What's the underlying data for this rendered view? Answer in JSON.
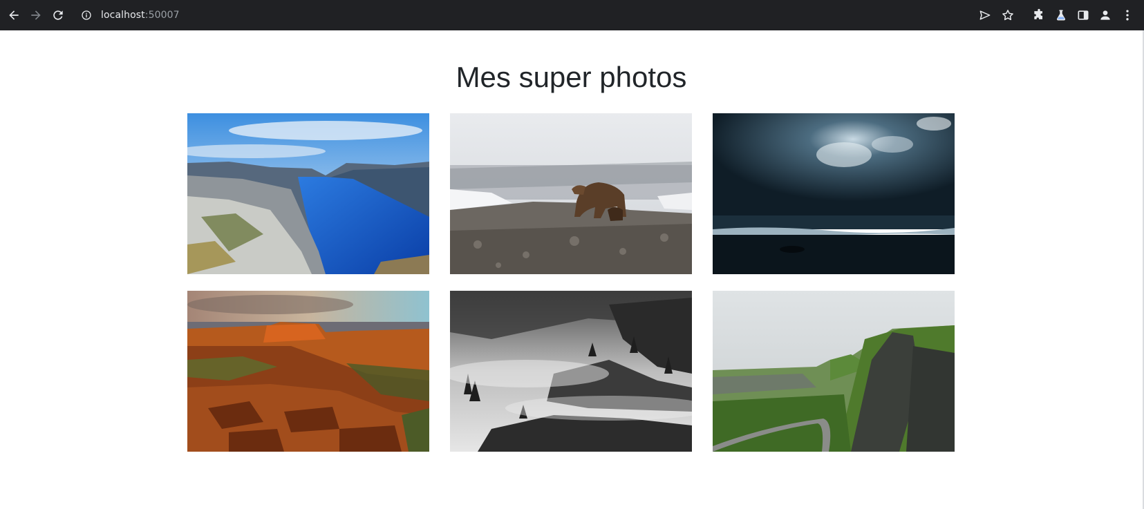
{
  "browser": {
    "url_host": "localhost",
    "url_port": ":50007",
    "icons": [
      "back-arrow-icon",
      "forward-arrow-icon",
      "reload-icon",
      "site-info-icon",
      "send-icon",
      "star-icon",
      "extensions-icon",
      "lab-flask-icon",
      "side-panel-icon",
      "profile-icon",
      "more-vert-icon"
    ]
  },
  "page": {
    "title": "Mes super photos"
  },
  "gallery": {
    "photos": [
      {
        "subject": "fjord-cliff",
        "index": 1
      },
      {
        "subject": "bear-on-rocks",
        "index": 2
      },
      {
        "subject": "stormy-sea",
        "index": 3
      },
      {
        "subject": "red-canyon-sunset",
        "index": 4
      },
      {
        "subject": "misty-forest-bw",
        "index": 5
      },
      {
        "subject": "green-highlands-road",
        "index": 6
      }
    ]
  },
  "colors": {
    "toolbar_bg": "#202124",
    "title_text": "#212529"
  }
}
